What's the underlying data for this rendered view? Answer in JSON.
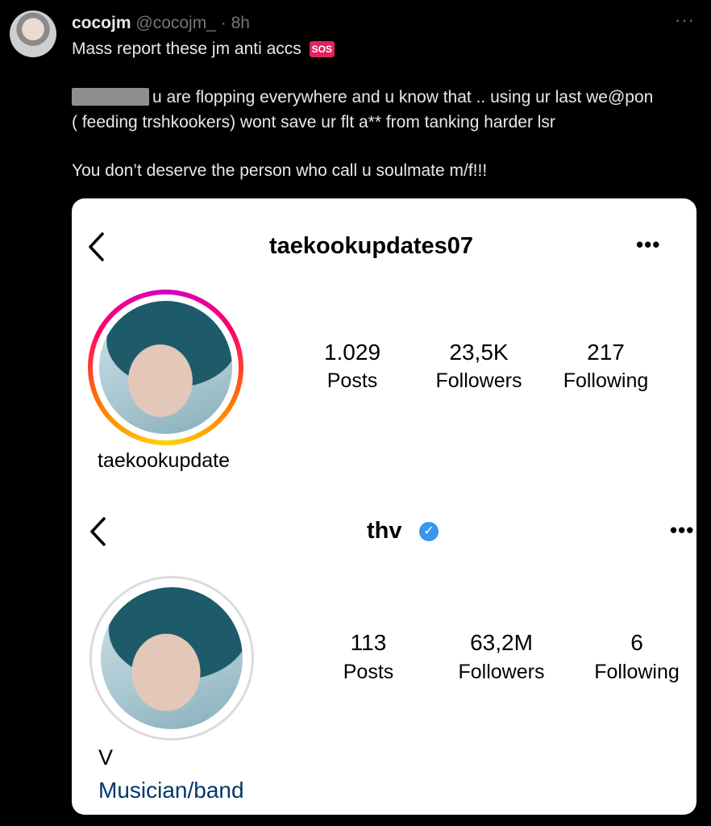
{
  "tweet": {
    "display_name": "cocojm",
    "handle": "@cocojm_",
    "separator": "·",
    "time": "8h",
    "more_icon": "ellipsis-icon",
    "line1": "Mass report these jm anti accs",
    "sos_label": "SOS",
    "para1_line1": "u are flopping everywhere and u know that .. using ur last we@pon",
    "para1_line2": "( feeding trshkookers) wont save ur flt a** from tanking harder lsr",
    "para2": "You don’t deserve the person who call u soulmate m/f!!!"
  },
  "profile1": {
    "username": "taekookupdates07",
    "name": "taekookupdate",
    "stats": [
      {
        "value": "1.029",
        "label": "Posts"
      },
      {
        "value": "23,5K",
        "label": "Followers"
      },
      {
        "value": "217",
        "label": "Following"
      }
    ]
  },
  "profile2": {
    "username": "thv",
    "verified_icon": "verified-badge-icon",
    "name": "V",
    "category": "Musician/band",
    "stats": [
      {
        "value": "113",
        "label": "Posts"
      },
      {
        "value": "63,2M",
        "label": "Followers"
      },
      {
        "value": "6",
        "label": "Following"
      }
    ]
  },
  "colors": {
    "background": "#000000",
    "text": "#e7e9ea",
    "muted": "#71767b",
    "verified": "#3797f0",
    "category_link": "#00376b"
  }
}
